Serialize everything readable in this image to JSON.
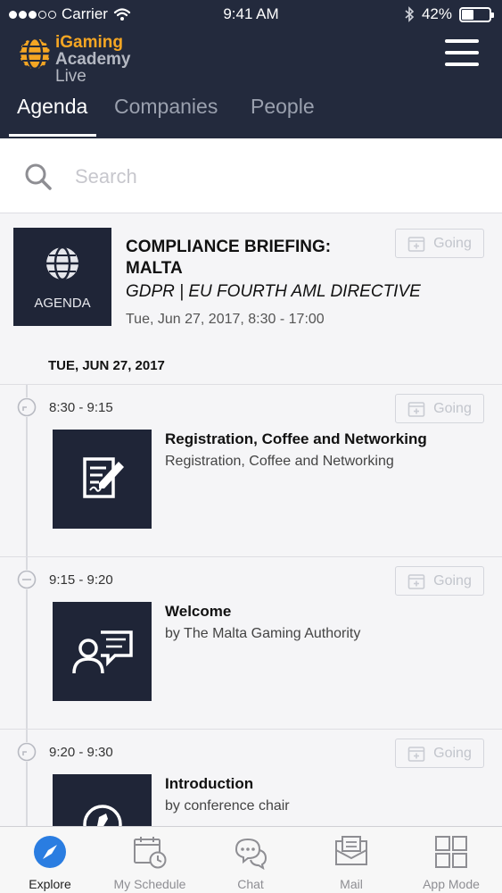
{
  "status_bar": {
    "carrier": "Carrier",
    "time": "9:41 AM",
    "battery": "42%",
    "battery_level": 0.42
  },
  "brand": {
    "line1": "iGaming",
    "line2": "Academy",
    "line3": "Live",
    "accent_color": "#f5a623"
  },
  "header": {
    "background": "#232a3d",
    "tabs": [
      {
        "label": "Agenda",
        "active": true
      },
      {
        "label": "Companies",
        "active": false
      },
      {
        "label": "People",
        "active": false
      }
    ]
  },
  "search": {
    "placeholder": "Search",
    "value": ""
  },
  "event": {
    "thumb_label": "AGENDA",
    "title": "COMPLIANCE BRIEFING: MALTA",
    "subtitle": "GDPR   |  EU FOURTH AML DIRECTIVE",
    "date": "Tue, Jun 27, 2017, 8:30 - 17:00",
    "going_label": "Going"
  },
  "day_heading": "TUE, JUN 27, 2017",
  "sessions": [
    {
      "time": "8:30 - 9:15",
      "title": "Registration, Coffee and Networking",
      "description": "Registration, Coffee and Networking",
      "going_label": "Going",
      "icon": "document-signature-icon"
    },
    {
      "time": "9:15 - 9:20",
      "title": "Welcome",
      "description": "by The Malta Gaming Authority",
      "going_label": "Going",
      "icon": "speaker-icon"
    },
    {
      "time": "9:20 - 9:30",
      "title": "Introduction",
      "description": "by conference chair",
      "going_label": "Going",
      "icon": "microphone-icon"
    }
  ],
  "tabbar": {
    "items": [
      {
        "label": "Explore",
        "icon": "compass-icon",
        "active": true
      },
      {
        "label": "My Schedule",
        "icon": "calendar-clock-icon",
        "active": false
      },
      {
        "label": "Chat",
        "icon": "chat-bubbles-icon",
        "active": false
      },
      {
        "label": "Mail",
        "icon": "mail-icon",
        "active": false
      },
      {
        "label": "App Mode",
        "icon": "grid-icon",
        "active": false
      }
    ],
    "active_color": "#2a7de1"
  }
}
